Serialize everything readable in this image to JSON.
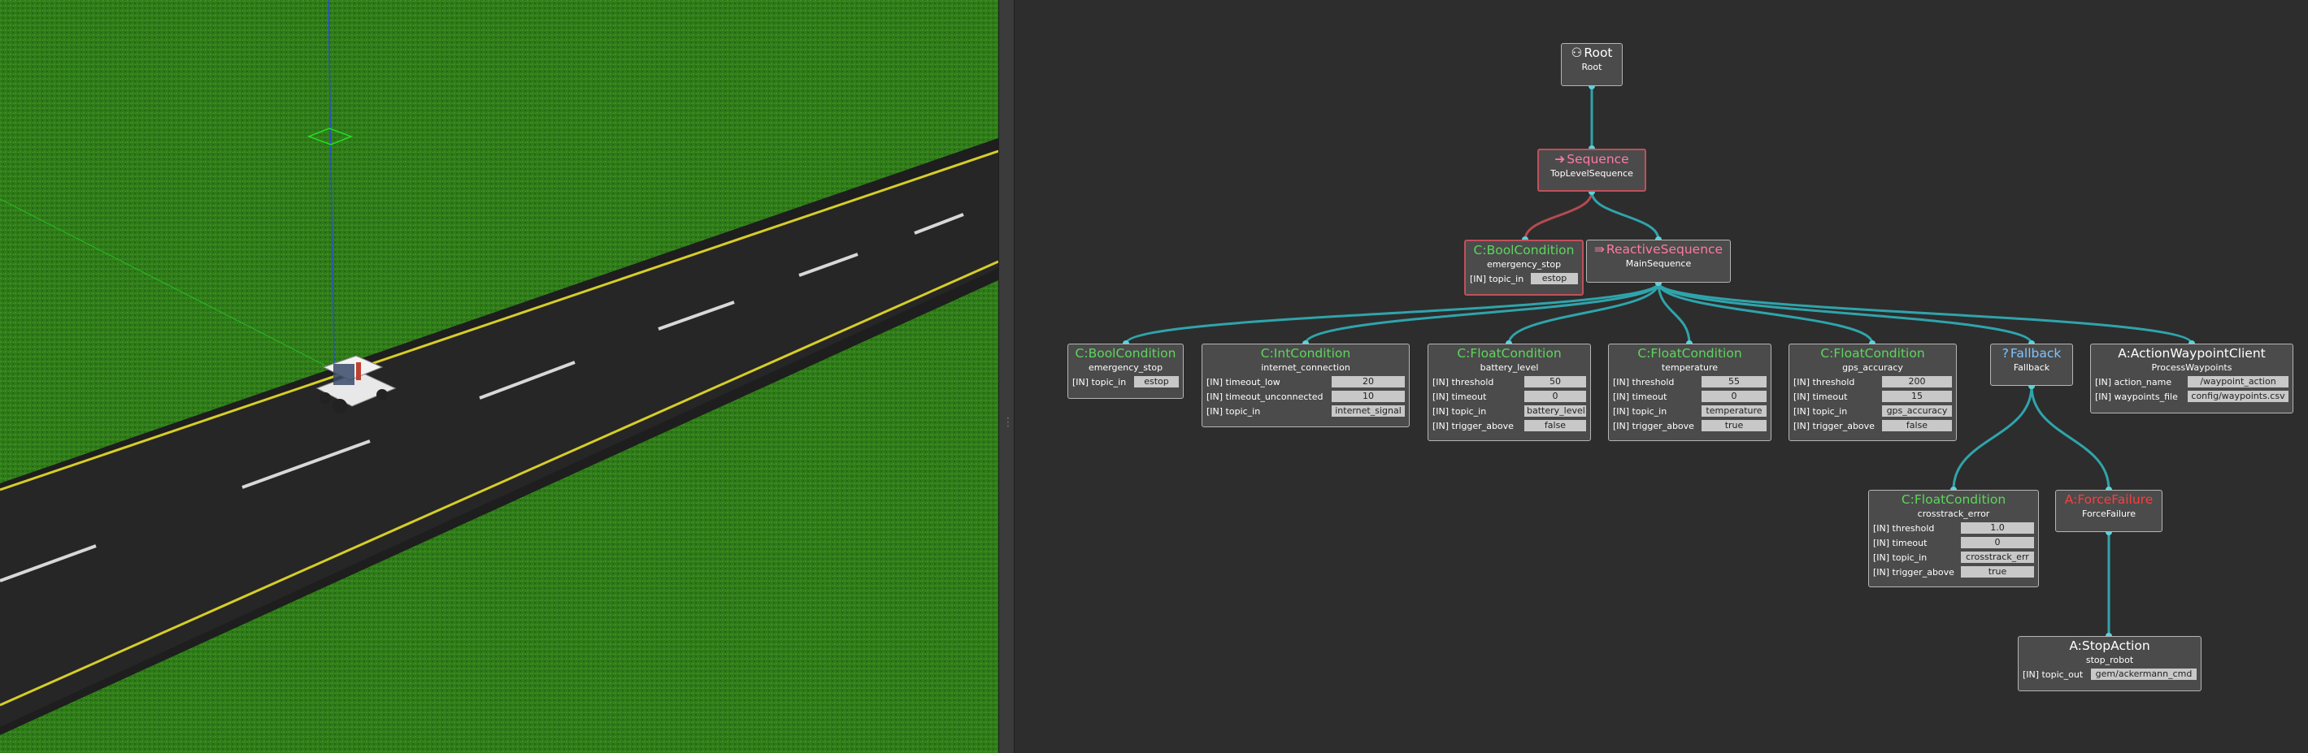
{
  "colors": {
    "edge": "#2fa4ab",
    "edge_selected": "#b54a52",
    "node_bg": "#4b4b4b",
    "condition": "#5cd65c",
    "control": "#ff7aa2",
    "fallback": "#7fc4ff",
    "decorator": "#ff3c3c",
    "grass": "#2e7a16",
    "road": "#262626",
    "road_line_yellow": "#d6cd2a"
  },
  "tree": {
    "root": {
      "icon": "tree-icon",
      "title": "Root",
      "sub": "Root"
    },
    "sequence": {
      "icon": "arrow-right-icon",
      "title": "Sequence",
      "sub": "TopLevelSequence"
    },
    "bool_estop": {
      "prefix": "C:",
      "title": "BoolCondition",
      "sub": "emergency_stop",
      "ports": [
        {
          "name": "[IN] topic_in",
          "value": "estop"
        }
      ]
    },
    "reactive": {
      "icon": "reactive-arrow-icon",
      "title": "ReactiveSequence",
      "sub": "MainSequence"
    },
    "bool2": {
      "prefix": "C:",
      "title": "BoolCondition",
      "sub": "emergency_stop",
      "ports": [
        {
          "name": "[IN] topic_in",
          "value": "estop"
        }
      ]
    },
    "int_cond": {
      "prefix": "C:",
      "title": "IntCondition",
      "sub": "internet_connection",
      "ports": [
        {
          "name": "[IN] timeout_low",
          "value": "20"
        },
        {
          "name": "[IN] timeout_unconnected",
          "value": "10"
        },
        {
          "name": "[IN] topic_in",
          "value": "internet_signal"
        }
      ]
    },
    "battery": {
      "prefix": "C:",
      "title": "FloatCondition",
      "sub": "battery_level",
      "ports": [
        {
          "name": "[IN] threshold",
          "value": "50"
        },
        {
          "name": "[IN] timeout",
          "value": "0"
        },
        {
          "name": "[IN] topic_in",
          "value": "battery_level"
        },
        {
          "name": "[IN] trigger_above",
          "value": "false"
        }
      ]
    },
    "temperature": {
      "prefix": "C:",
      "title": "FloatCondition",
      "sub": "temperature",
      "ports": [
        {
          "name": "[IN] threshold",
          "value": "55"
        },
        {
          "name": "[IN] timeout",
          "value": "0"
        },
        {
          "name": "[IN] topic_in",
          "value": "temperature"
        },
        {
          "name": "[IN] trigger_above",
          "value": "true"
        }
      ]
    },
    "gps": {
      "prefix": "C:",
      "title": "FloatCondition",
      "sub": "gps_accuracy",
      "ports": [
        {
          "name": "[IN] threshold",
          "value": "200"
        },
        {
          "name": "[IN] timeout",
          "value": "15"
        },
        {
          "name": "[IN] topic_in",
          "value": "gps_accuracy"
        },
        {
          "name": "[IN] trigger_above",
          "value": "false"
        }
      ]
    },
    "fallback": {
      "prefix": "?",
      "title": "Fallback",
      "sub": "Fallback"
    },
    "waypoint": {
      "prefix": "A:",
      "title": "ActionWaypointClient",
      "sub": "ProcessWaypoints",
      "ports": [
        {
          "name": "[IN] action_name",
          "value": "/waypoint_action"
        },
        {
          "name": "[IN] waypoints_file",
          "value": "config/waypoints.csv"
        }
      ]
    },
    "crosstrack": {
      "prefix": "C:",
      "title": "FloatCondition",
      "sub": "crosstrack_error",
      "ports": [
        {
          "name": "[IN] threshold",
          "value": "1.0"
        },
        {
          "name": "[IN] timeout",
          "value": "0"
        },
        {
          "name": "[IN] topic_in",
          "value": "crosstrack_err"
        },
        {
          "name": "[IN] trigger_above",
          "value": "true"
        }
      ]
    },
    "force_failure": {
      "prefix": "A:",
      "title": "ForceFailure",
      "sub": "ForceFailure"
    },
    "stop_action": {
      "prefix": "A:",
      "title": "StopAction",
      "sub": "stop_robot",
      "ports": [
        {
          "name": "[IN] topic_out",
          "value": "gem/ackermann_cmd"
        }
      ]
    }
  }
}
